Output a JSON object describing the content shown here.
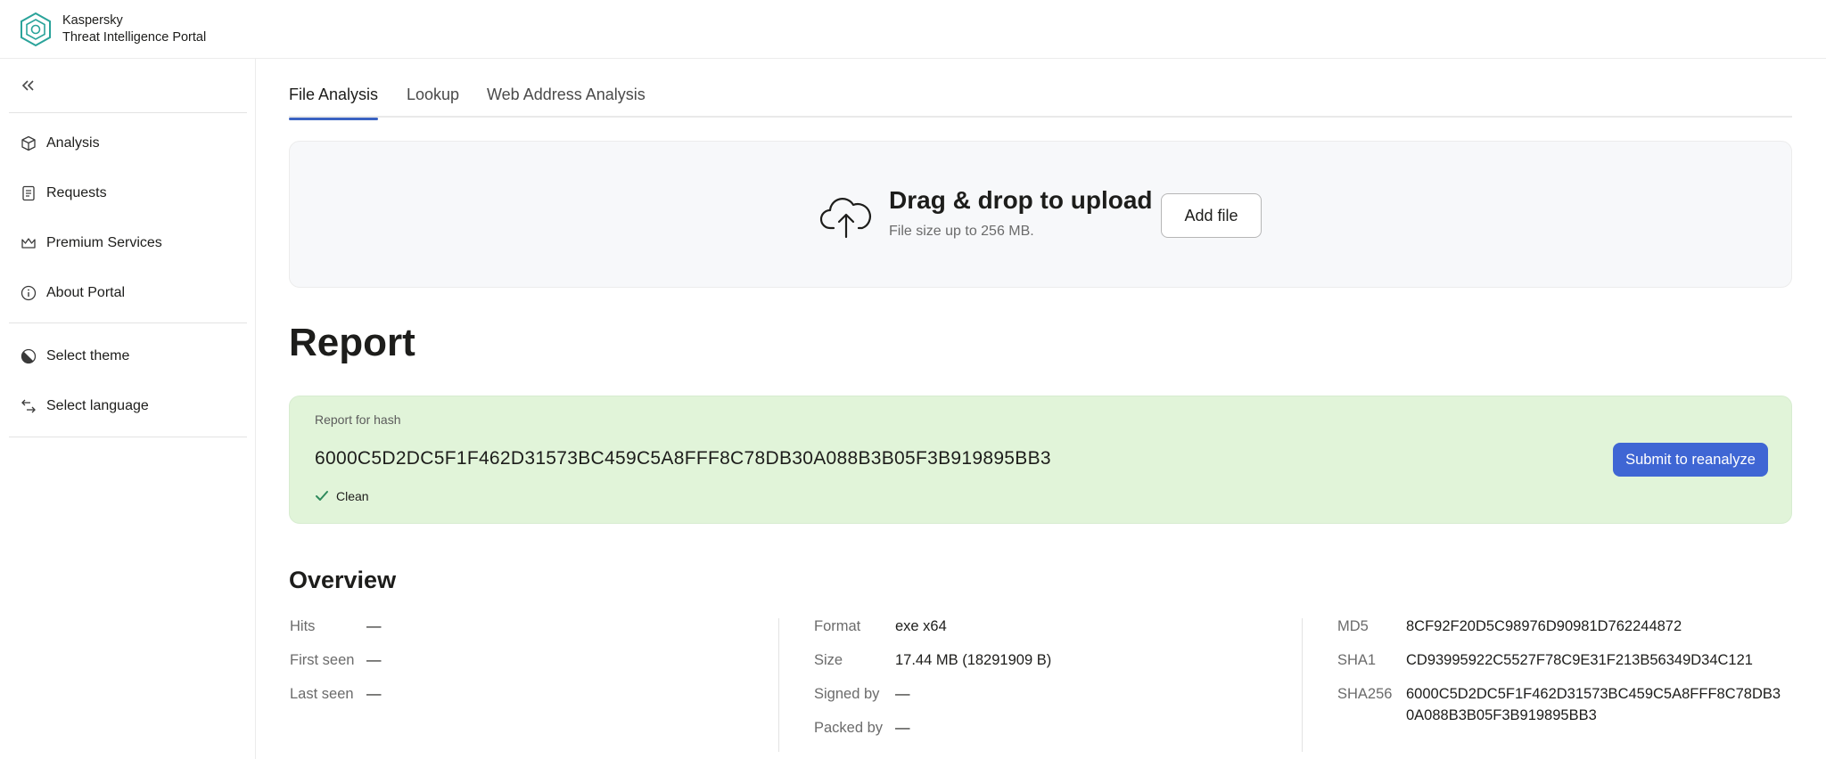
{
  "app": {
    "brand_line1": "Kaspersky",
    "brand_line2": "Threat Intelligence Portal",
    "accent": "#3f66d4",
    "clean_color": "#e1f4d9"
  },
  "sidebar": {
    "items": [
      {
        "label": "Analysis",
        "icon": "cube-icon"
      },
      {
        "label": "Requests",
        "icon": "document-icon"
      },
      {
        "label": "Premium Services",
        "icon": "crown-icon"
      },
      {
        "label": "About Portal",
        "icon": "info-icon"
      }
    ],
    "settings": [
      {
        "label": "Select theme",
        "icon": "theme-icon"
      },
      {
        "label": "Select language",
        "icon": "language-icon"
      }
    ]
  },
  "tabs": [
    {
      "label": "File Analysis",
      "active": true
    },
    {
      "label": "Lookup",
      "active": false
    },
    {
      "label": "Web Address Analysis",
      "active": false
    }
  ],
  "upload": {
    "title": "Drag & drop to upload",
    "subtitle": "File size up to 256 MB.",
    "button": "Add file"
  },
  "report": {
    "title": "Report",
    "caption": "Report for hash",
    "hash": "6000C5D2DC5F1F462D31573BC459C5A8FFF8C78DB30A088B3B05F3B919895BB3",
    "status": "Clean",
    "reanalyze_button": "Submit to reanalyze"
  },
  "overview": {
    "title": "Overview",
    "col1": [
      {
        "key": "Hits",
        "value": "—"
      },
      {
        "key": "First seen",
        "value": "—"
      },
      {
        "key": "Last seen",
        "value": "—"
      }
    ],
    "col2": [
      {
        "key": "Format",
        "value": "exe x64"
      },
      {
        "key": "Size",
        "value": "17.44 MB (18291909 B)"
      },
      {
        "key": "Signed by",
        "value": "—"
      },
      {
        "key": "Packed by",
        "value": "—"
      }
    ],
    "col3": [
      {
        "key": "MD5",
        "value": "8CF92F20D5C98976D90981D762244872"
      },
      {
        "key": "SHA1",
        "value": "CD93995922C5527F78C9E31F213B56349D34C121"
      },
      {
        "key": "SHA256",
        "value_line1": "6000C5D2DC5F1F462D31573BC459C5A8FFF8C78DB3",
        "value_line2": "0A088B3B05F3B919895BB3"
      }
    ]
  }
}
